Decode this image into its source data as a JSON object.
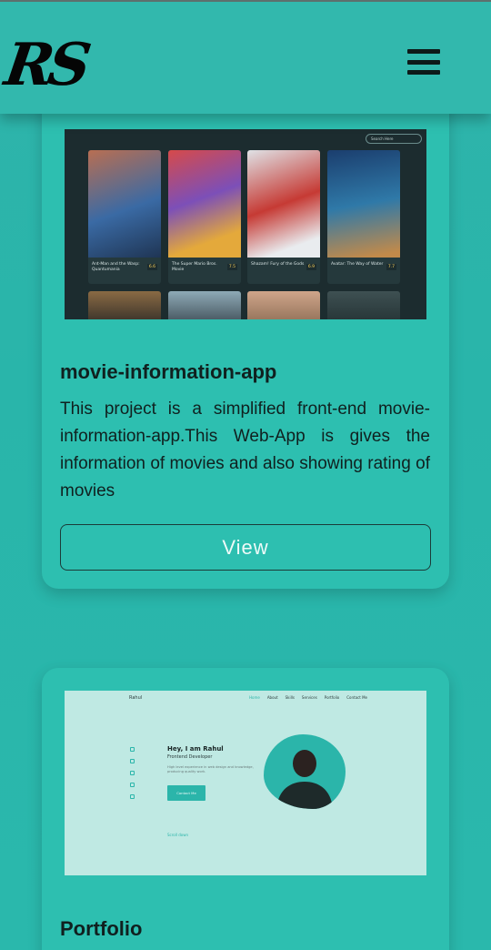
{
  "header": {
    "logo_text": "RS",
    "menu_icon": "hamburger-icon"
  },
  "projects": [
    {
      "title": "movie-information-app",
      "description": "This project is a simplified front-end movie-information-app.This Web-App is gives the information of movies and also showing rating of movies",
      "button_label": "View",
      "screenshot": {
        "search_placeholder": "Search Here",
        "movies": [
          {
            "name": "Ant-Man and the Wasp: Quantumania",
            "rating": "6.6"
          },
          {
            "name": "The Super Mario Bros. Movie",
            "rating": "7.5"
          },
          {
            "name": "Shazam! Fury of the Gods",
            "rating": "6.9"
          },
          {
            "name": "Avatar: The Way of Water",
            "rating": "7.7"
          }
        ]
      }
    },
    {
      "title": "Portfolio",
      "screenshot": {
        "brand": "Rahul",
        "nav": [
          "Home",
          "About",
          "Skills",
          "Services",
          "Portfolio",
          "Contact Me"
        ],
        "greeting": "Hey, I am Rahul",
        "role": "Frontend Developer",
        "intro": "High level experience in web design and knowledge, producing quality work.",
        "contact_button": "Contact Me",
        "scroll_label": "Scroll down"
      }
    }
  ],
  "colors": {
    "background": "#2ab8ac",
    "card": "#2dbfb0",
    "accent": "#2bb5aa"
  }
}
